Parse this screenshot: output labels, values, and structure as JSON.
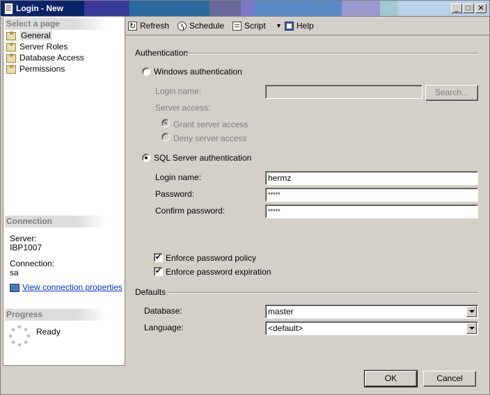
{
  "window": {
    "title": "Login - New"
  },
  "left_panel": {
    "select_page_header": "Select a page",
    "pages": [
      {
        "label": "General",
        "selected": true
      },
      {
        "label": "Server Roles",
        "selected": false
      },
      {
        "label": "Database Access",
        "selected": false
      },
      {
        "label": "Permissions",
        "selected": false
      }
    ],
    "connection_header": "Connection",
    "server_label": "Server:",
    "server_value": "IBP1007",
    "connection_label": "Connection:",
    "connection_value": "sa",
    "view_connection_link": "View connection properties",
    "progress_header": "Progress",
    "progress_status": "Ready"
  },
  "toolbar": {
    "refresh": "Refresh",
    "schedule": "Schedule",
    "script": "Script",
    "help": "Help"
  },
  "authentication": {
    "group_label": "Authentication",
    "windows_auth_label": "Windows authentication",
    "windows_selected": false,
    "win_login_name_label": "Login name:",
    "win_login_name_value": "",
    "search_button": "Search...",
    "server_access_label": "Server access:",
    "grant_access_label": "Grant server access",
    "deny_access_label": "Deny server access",
    "sql_auth_label": "SQL Server authentication",
    "sql_selected": true,
    "sql_login_name_label": "Login name:",
    "sql_login_name_value": "hermz",
    "password_label": "Password:",
    "password_value": "*****",
    "confirm_password_label": "Confirm password:",
    "confirm_password_value": "*****",
    "enforce_policy_label": "Enforce password policy",
    "enforce_policy_checked": true,
    "enforce_expiration_label": "Enforce password expiration",
    "enforce_expiration_checked": true
  },
  "defaults": {
    "group_label": "Defaults",
    "database_label": "Database:",
    "database_value": "master",
    "language_label": "Language:",
    "language_value": "<default>"
  },
  "buttons": {
    "ok": "OK",
    "cancel": "Cancel"
  },
  "colors": {
    "title_bar_start": "#0a246a",
    "link": "#0033cc",
    "dialog_background": "#d4d0c8"
  }
}
